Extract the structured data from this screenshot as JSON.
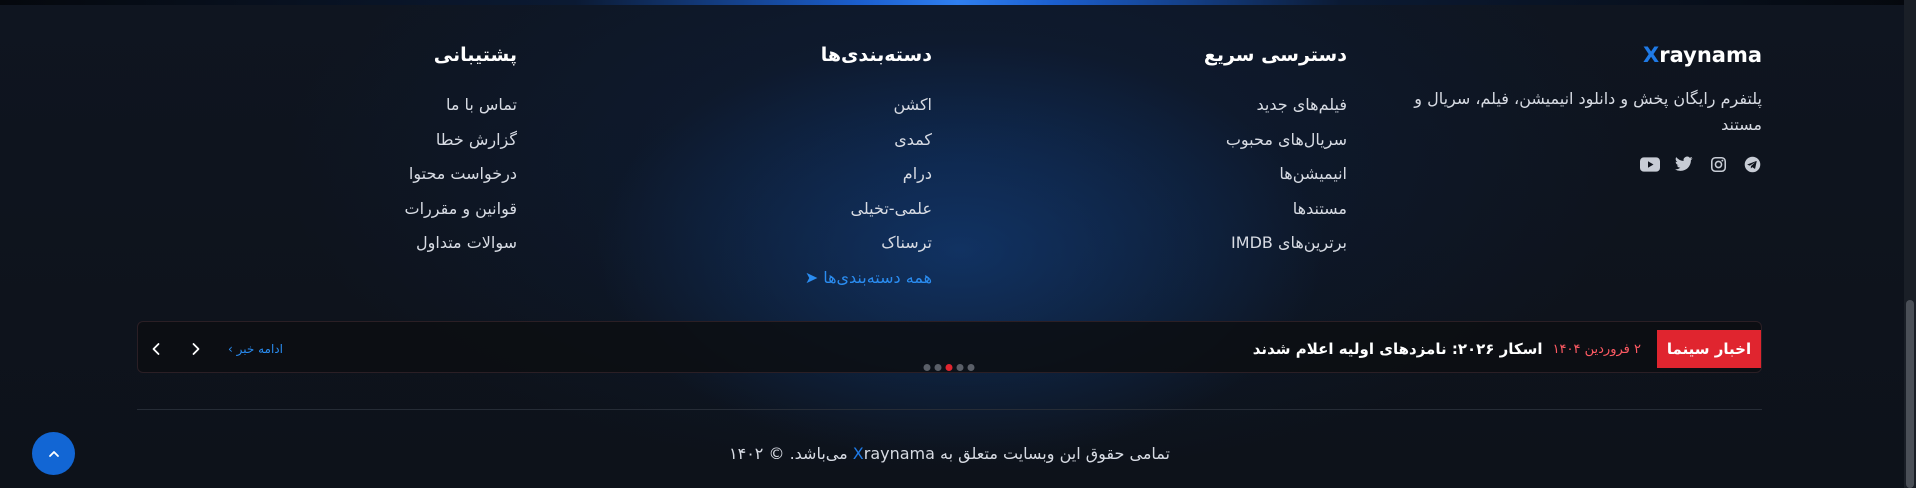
{
  "brand": {
    "logo_x": "X",
    "logo_rest": "raynama",
    "description": "پلتفرم رایگان پخش و دانلود انیمیشن، فیلم، سریال و مستند",
    "socials": [
      "telegram-icon",
      "instagram-icon",
      "twitter-icon",
      "youtube-icon"
    ]
  },
  "quick_access": {
    "title": "دسترسی سریع",
    "items": [
      "فیلم‌های جدید",
      "سریال‌های محبوب",
      "انیمیشن‌ها",
      "مستندها",
      "برترین‌های IMDB"
    ]
  },
  "categories": {
    "title": "دسته‌بندی‌ها",
    "items": [
      "اکشن",
      "کمدی",
      "درام",
      "علمی-تخیلی",
      "ترسناک"
    ],
    "all_link": "همه دسته‌بندی‌ها ➤"
  },
  "support": {
    "title": "پشتیبانی",
    "items": [
      "تماس با ما",
      "گزارش خطا",
      "درخواست محتوا",
      "قوانین و مقررات",
      "سوالات متداول"
    ]
  },
  "news": {
    "label": "اخبار سینما",
    "date": "۲ فروردین ۱۴۰۴",
    "title": "اسکار ۲۰۲۶: نامزدهای اولیه اعلام شدند",
    "read_more": "ادامه خبر ›",
    "dot_count": 5,
    "active_dot": 2
  },
  "footer": {
    "copyright_before": "تمامی حقوق این وبسایت متعلق به",
    "brand_x": "X",
    "brand_rest": "raynama",
    "copyright_after": "می‌باشد. © ۱۴۰۲"
  },
  "colors": {
    "accent": "#1f7ae6",
    "news_red": "#e0252f",
    "background": "#0e131c"
  }
}
